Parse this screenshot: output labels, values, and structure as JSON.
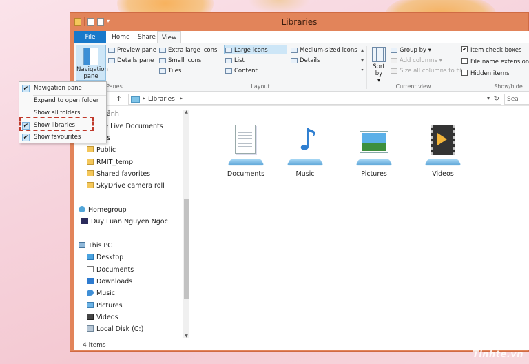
{
  "window": {
    "title": "Libraries"
  },
  "ribbon": {
    "tabs": [
      "File",
      "Home",
      "Share",
      "View"
    ],
    "panes": {
      "navigation_pane": "Navigation pane",
      "preview_pane": "Preview pane",
      "details_pane": "Details pane",
      "label": "Panes"
    },
    "layout": {
      "items": [
        "Extra large icons",
        "Large icons",
        "Medium-sized icons",
        "Small icons",
        "List",
        "Details",
        "Tiles",
        "Content"
      ],
      "selected": "Large icons",
      "label": "Layout"
    },
    "current_view": {
      "sort_by": "Sort by",
      "group_by": "Group by",
      "add_columns": "Add columns",
      "size_all_columns": "Size all columns to fit",
      "label": "Current view"
    },
    "show_hide": {
      "item_check_boxes": "Item check boxes",
      "file_name_extensions": "File name extensions",
      "hidden_items": "Hidden items",
      "label": "Show/hide"
    }
  },
  "address": {
    "path": "Libraries",
    "search_placeholder": "Sea"
  },
  "nav_tree": {
    "items": [
      "nh ảnh",
      "fice Live Documents",
      "otos",
      "Public",
      "RMIT_temp",
      "Shared favorites",
      "SkyDrive camera roll",
      "Homegroup",
      "Duy Luan Nguyen Ngoc",
      "This PC",
      "Desktop",
      "Documents",
      "Downloads",
      "Music",
      "Pictures",
      "Videos",
      "Local Disk (C:)"
    ]
  },
  "libraries": [
    "Documents",
    "Music",
    "Pictures",
    "Videos"
  ],
  "status": {
    "count": "4 items"
  },
  "nav_menu": {
    "items": [
      {
        "label": "Navigation pane",
        "checked": true
      },
      {
        "label": "Expand to open folder",
        "checked": false
      },
      {
        "label": "Show all folders",
        "checked": false
      },
      {
        "label": "Show libraries",
        "checked": true
      },
      {
        "label": "Show favourites",
        "checked": true
      }
    ]
  },
  "watermark": "Tinhte.vn"
}
